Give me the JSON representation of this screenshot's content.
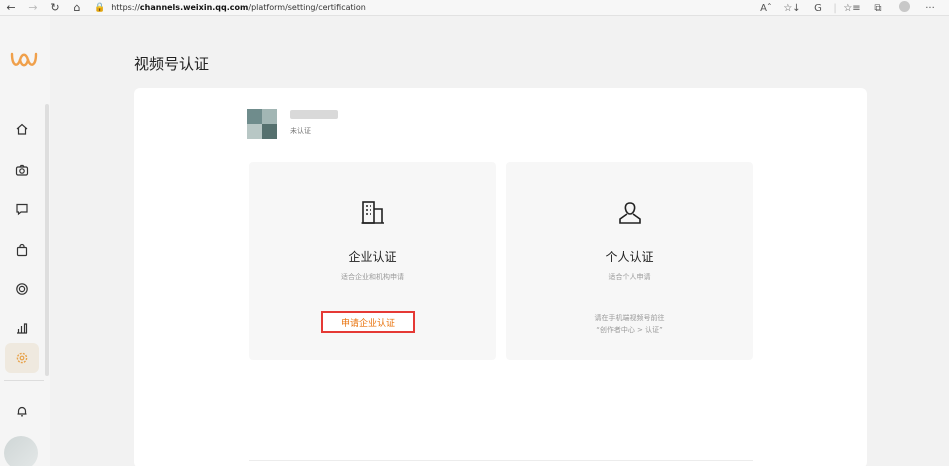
{
  "browser": {
    "url_prefix": "https://",
    "url_host": "channels.weixin.qq.com",
    "url_path": "/platform/setting/certification",
    "tools": [
      "Aˆ",
      "☆↓",
      "G",
      "☆≡",
      "⧉",
      "···"
    ]
  },
  "page": {
    "title": "视频号认证"
  },
  "account": {
    "status": "未认证"
  },
  "options": {
    "enterprise": {
      "title": "企业认证",
      "desc": "适合企业和机构申请",
      "button": "申请企业认证"
    },
    "personal": {
      "title": "个人认证",
      "desc": "适合个人申请",
      "hint_line1": "请在手机端视频号前往",
      "hint_line2": "“创作者中心 > 认证”"
    }
  },
  "colors": {
    "accent": "#e8710a",
    "highlight_border": "#e53935",
    "logo": "#f0a04b"
  }
}
